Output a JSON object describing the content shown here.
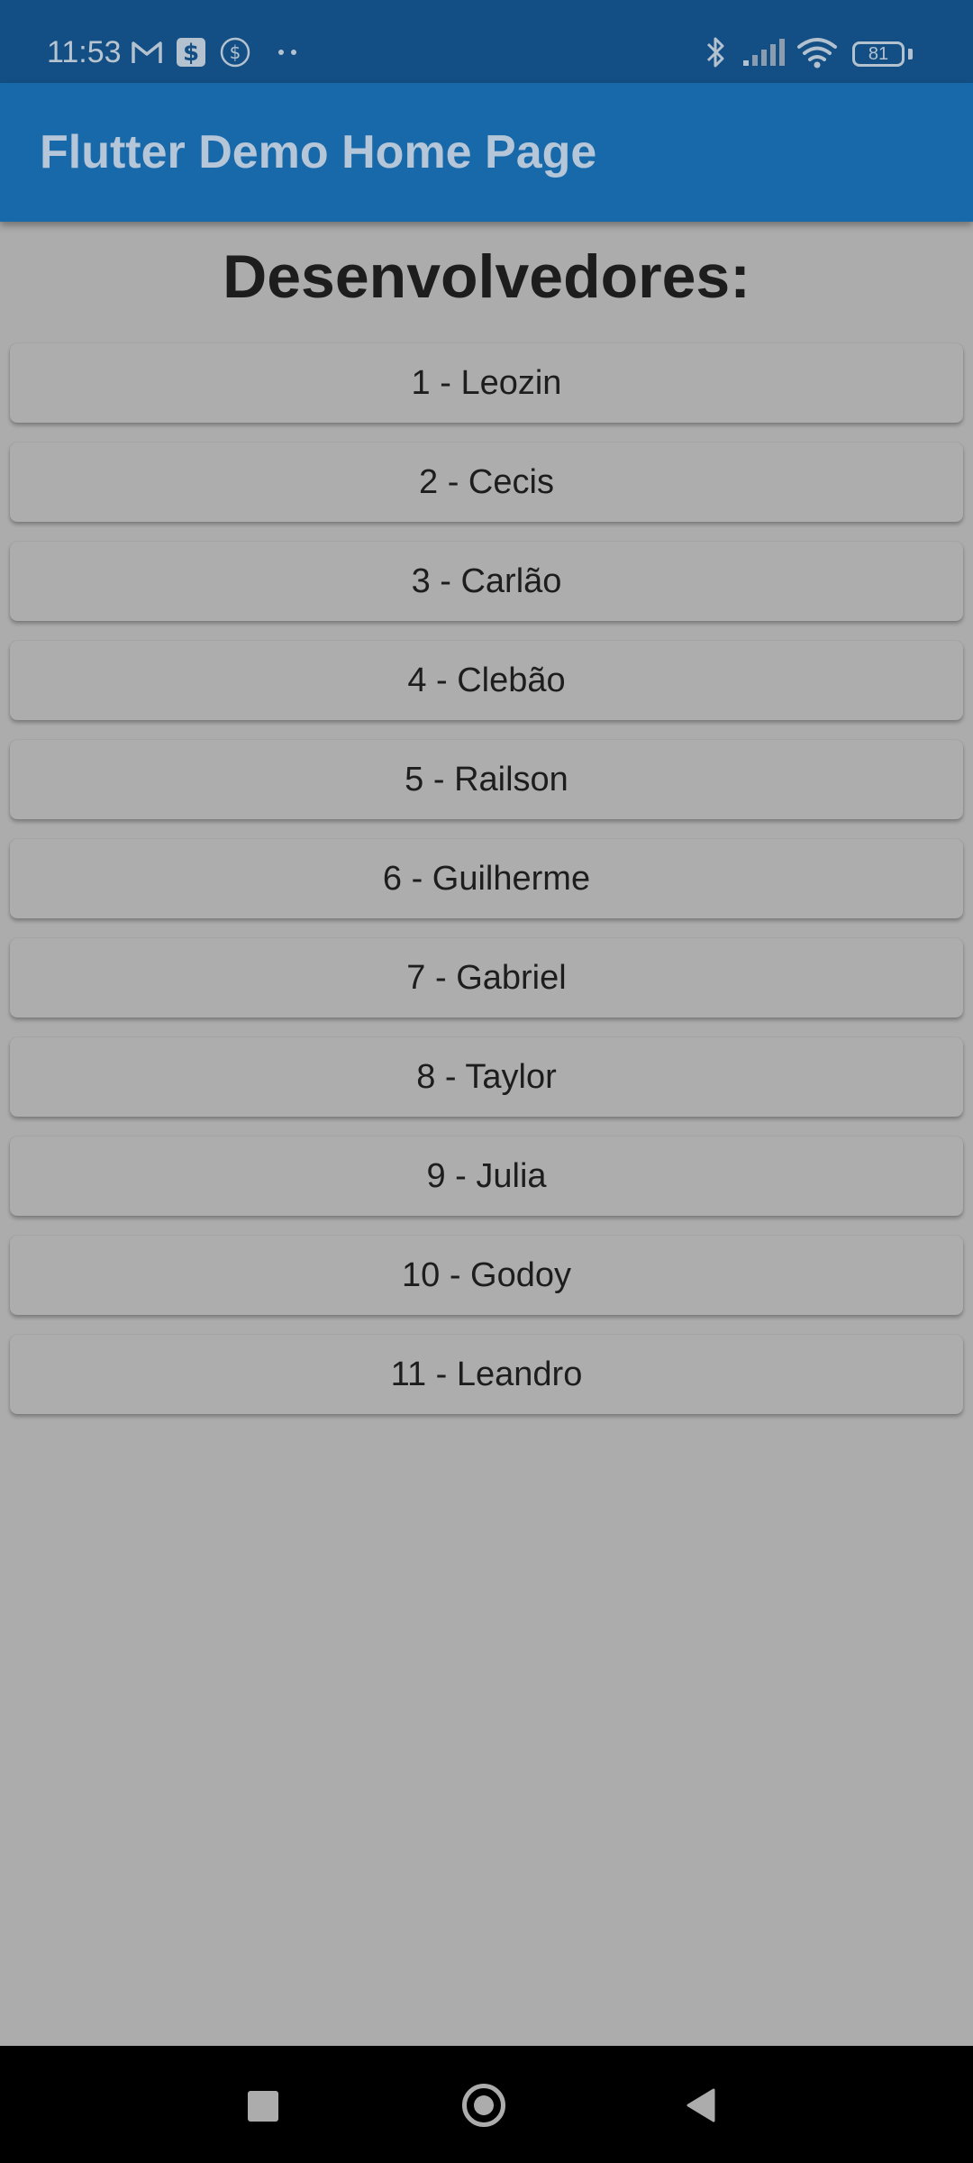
{
  "status_bar": {
    "time": "11:53",
    "battery": "81",
    "icons": [
      "gmail-icon",
      "dollar-box-icon",
      "dollar-circle-icon",
      "more-dots-icon",
      "bluetooth-icon",
      "signal-icon",
      "wifi-icon",
      "battery-icon"
    ]
  },
  "app_bar": {
    "title": "Flutter Demo Home Page",
    "color": "#1869aa"
  },
  "main": {
    "heading": "Desenvolvedores:",
    "developers": [
      "1 - Leozin",
      "2 - Cecis",
      "3 - Carlão",
      "4 - Clebão",
      "5 - Railson",
      "6 - Guilherme",
      "7 - Gabriel",
      "8 - Taylor",
      "9 - Julia",
      "10 - Godoy",
      "11 - Leandro"
    ]
  },
  "nav_bar": {
    "icons": [
      "recents-square-icon",
      "home-circle-icon",
      "back-triangle-icon"
    ]
  }
}
